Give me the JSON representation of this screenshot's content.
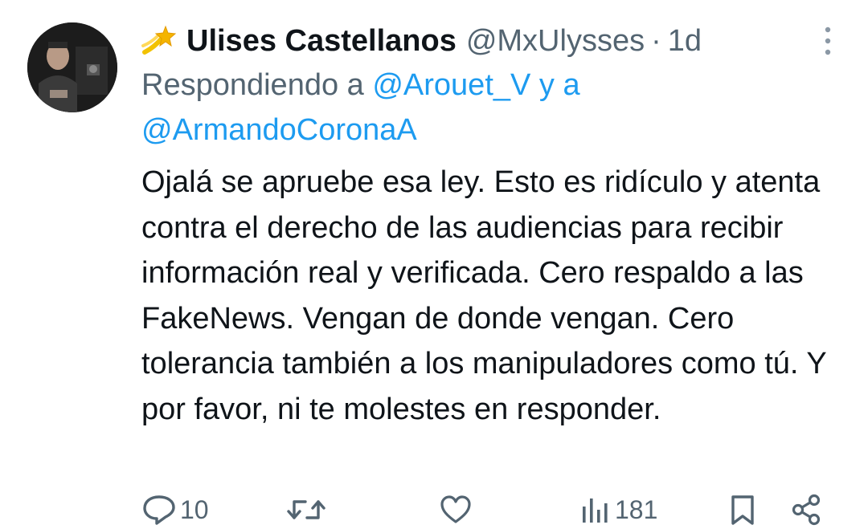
{
  "tweet": {
    "author": {
      "display_name": "Ulises Castellanos",
      "handle": "@MxUlysses",
      "badge_icon": "shooting-star-icon"
    },
    "separator": "·",
    "time": "1d",
    "reply": {
      "prefix": "Respondiendo a",
      "mention_1": "@Arouet_V",
      "connector": "y a",
      "mention_2": "@ArmandoCoronaA"
    },
    "text": "Ojalá se apruebe esa ley. Esto es ridículo y atenta contra el derecho de las audiencias para recibir información real y verificada. Cero respaldo a las FakeNews. Vengan de donde vengan. Cero tolerancia también a los manipuladores como tú. Y por favor, ni te molestes en responder.",
    "actions": {
      "reply_icon": "comment-icon",
      "reply_count": "10",
      "retweet_icon": "retweet-icon",
      "like_icon": "heart-icon",
      "views_icon": "views-chart-icon",
      "views_count": "181",
      "bookmark_icon": "bookmark-icon",
      "share_icon": "share-icon"
    }
  },
  "colors": {
    "text_primary": "#0f1419",
    "text_secondary": "#536471",
    "mention": "#1d9bf0",
    "icon_gray": "#536471",
    "emoji_gold": "#f4b400"
  }
}
